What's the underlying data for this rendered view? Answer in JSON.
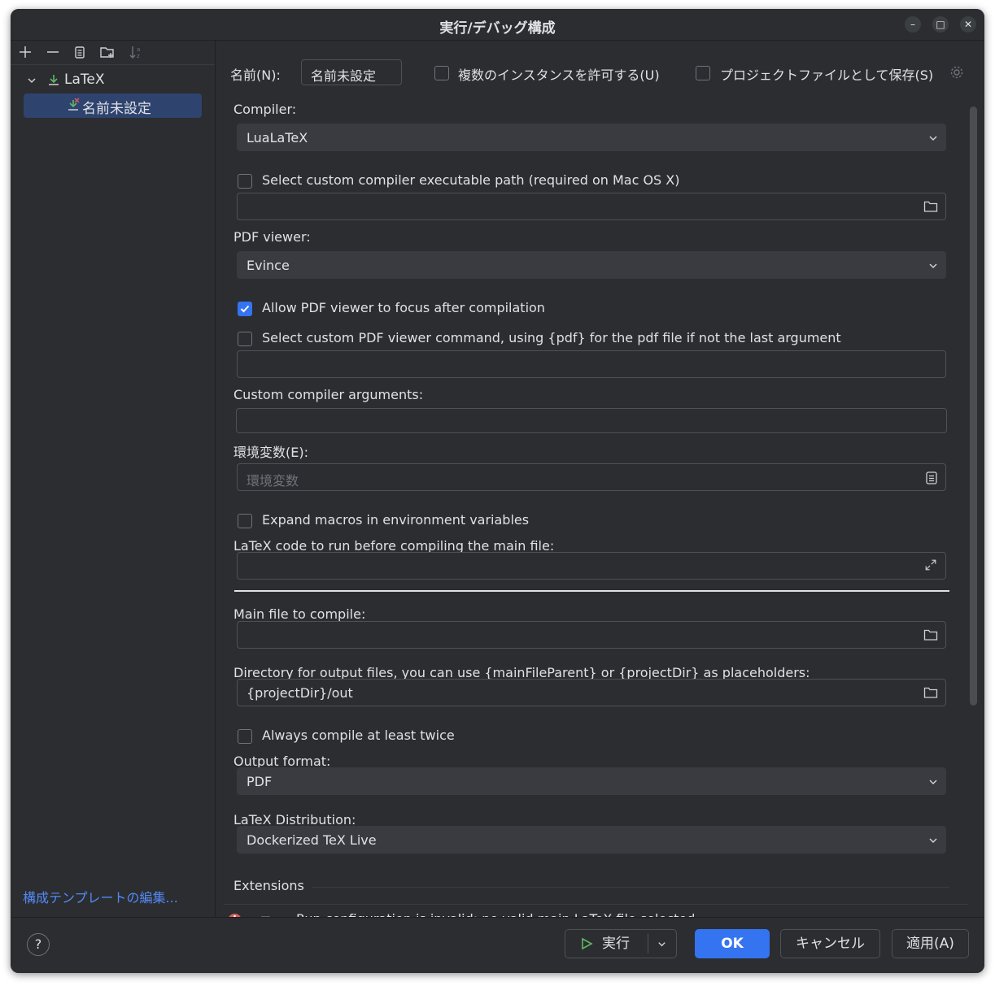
{
  "window": {
    "title": "実行/デバッグ構成"
  },
  "sidebar": {
    "toolbar": [
      "add-icon",
      "remove-icon",
      "copy-icon",
      "new-folder-icon",
      "sort-icon"
    ],
    "tree": {
      "group_label": "LaTeX",
      "item_label": "名前未設定"
    },
    "edit_templates": "構成テンプレートの編集..."
  },
  "header": {
    "name_label": "名前(N):",
    "name_value": "名前未設定",
    "allow_multiple": "複数のインスタンスを許可する(U)",
    "store_as_project_file": "プロジェクトファイルとして保存(S)"
  },
  "form": {
    "compiler_label": "Compiler:",
    "compiler_value": "LuaLaTeX",
    "custom_compiler_path": "Select custom compiler executable path (required on Mac OS X)",
    "pdf_viewer_label": "PDF viewer:",
    "pdf_viewer_value": "Evince",
    "allow_focus": "Allow PDF viewer to focus after compilation",
    "custom_viewer_cmd": "Select custom PDF viewer command, using {pdf} for the pdf file if not the last argument",
    "custom_args_label": "Custom compiler arguments:",
    "env_label": "環境変数(E):",
    "env_placeholder": "環境変数",
    "expand_macros": "Expand macros in environment variables",
    "latex_code_label": "LaTeX code to run before compiling the main file:",
    "main_file_label": "Main file to compile:",
    "output_dir_label": "Directory for output files, you can use {mainFileParent} or {projectDir} as placeholders:",
    "output_dir_value": "{projectDir}/out",
    "compile_twice": "Always compile at least twice",
    "output_format_label": "Output format:",
    "output_format_value": "PDF",
    "distribution_label": "LaTeX Distribution:",
    "distribution_value": "Dockerized TeX Live",
    "extensions_label": "Extensions"
  },
  "error": {
    "prefix": "エラー:",
    "message": "Run configuration is invalid: no valid main LaTeX file selected"
  },
  "footer": {
    "help": "?",
    "run": "実行",
    "ok": "OK",
    "cancel": "キャンセル",
    "apply": "適用(A)"
  },
  "colors": {
    "background": "#2b2d30",
    "accent": "#3574f0",
    "selection": "#2e436e",
    "link": "#548af7",
    "error": "#db5c5c"
  }
}
